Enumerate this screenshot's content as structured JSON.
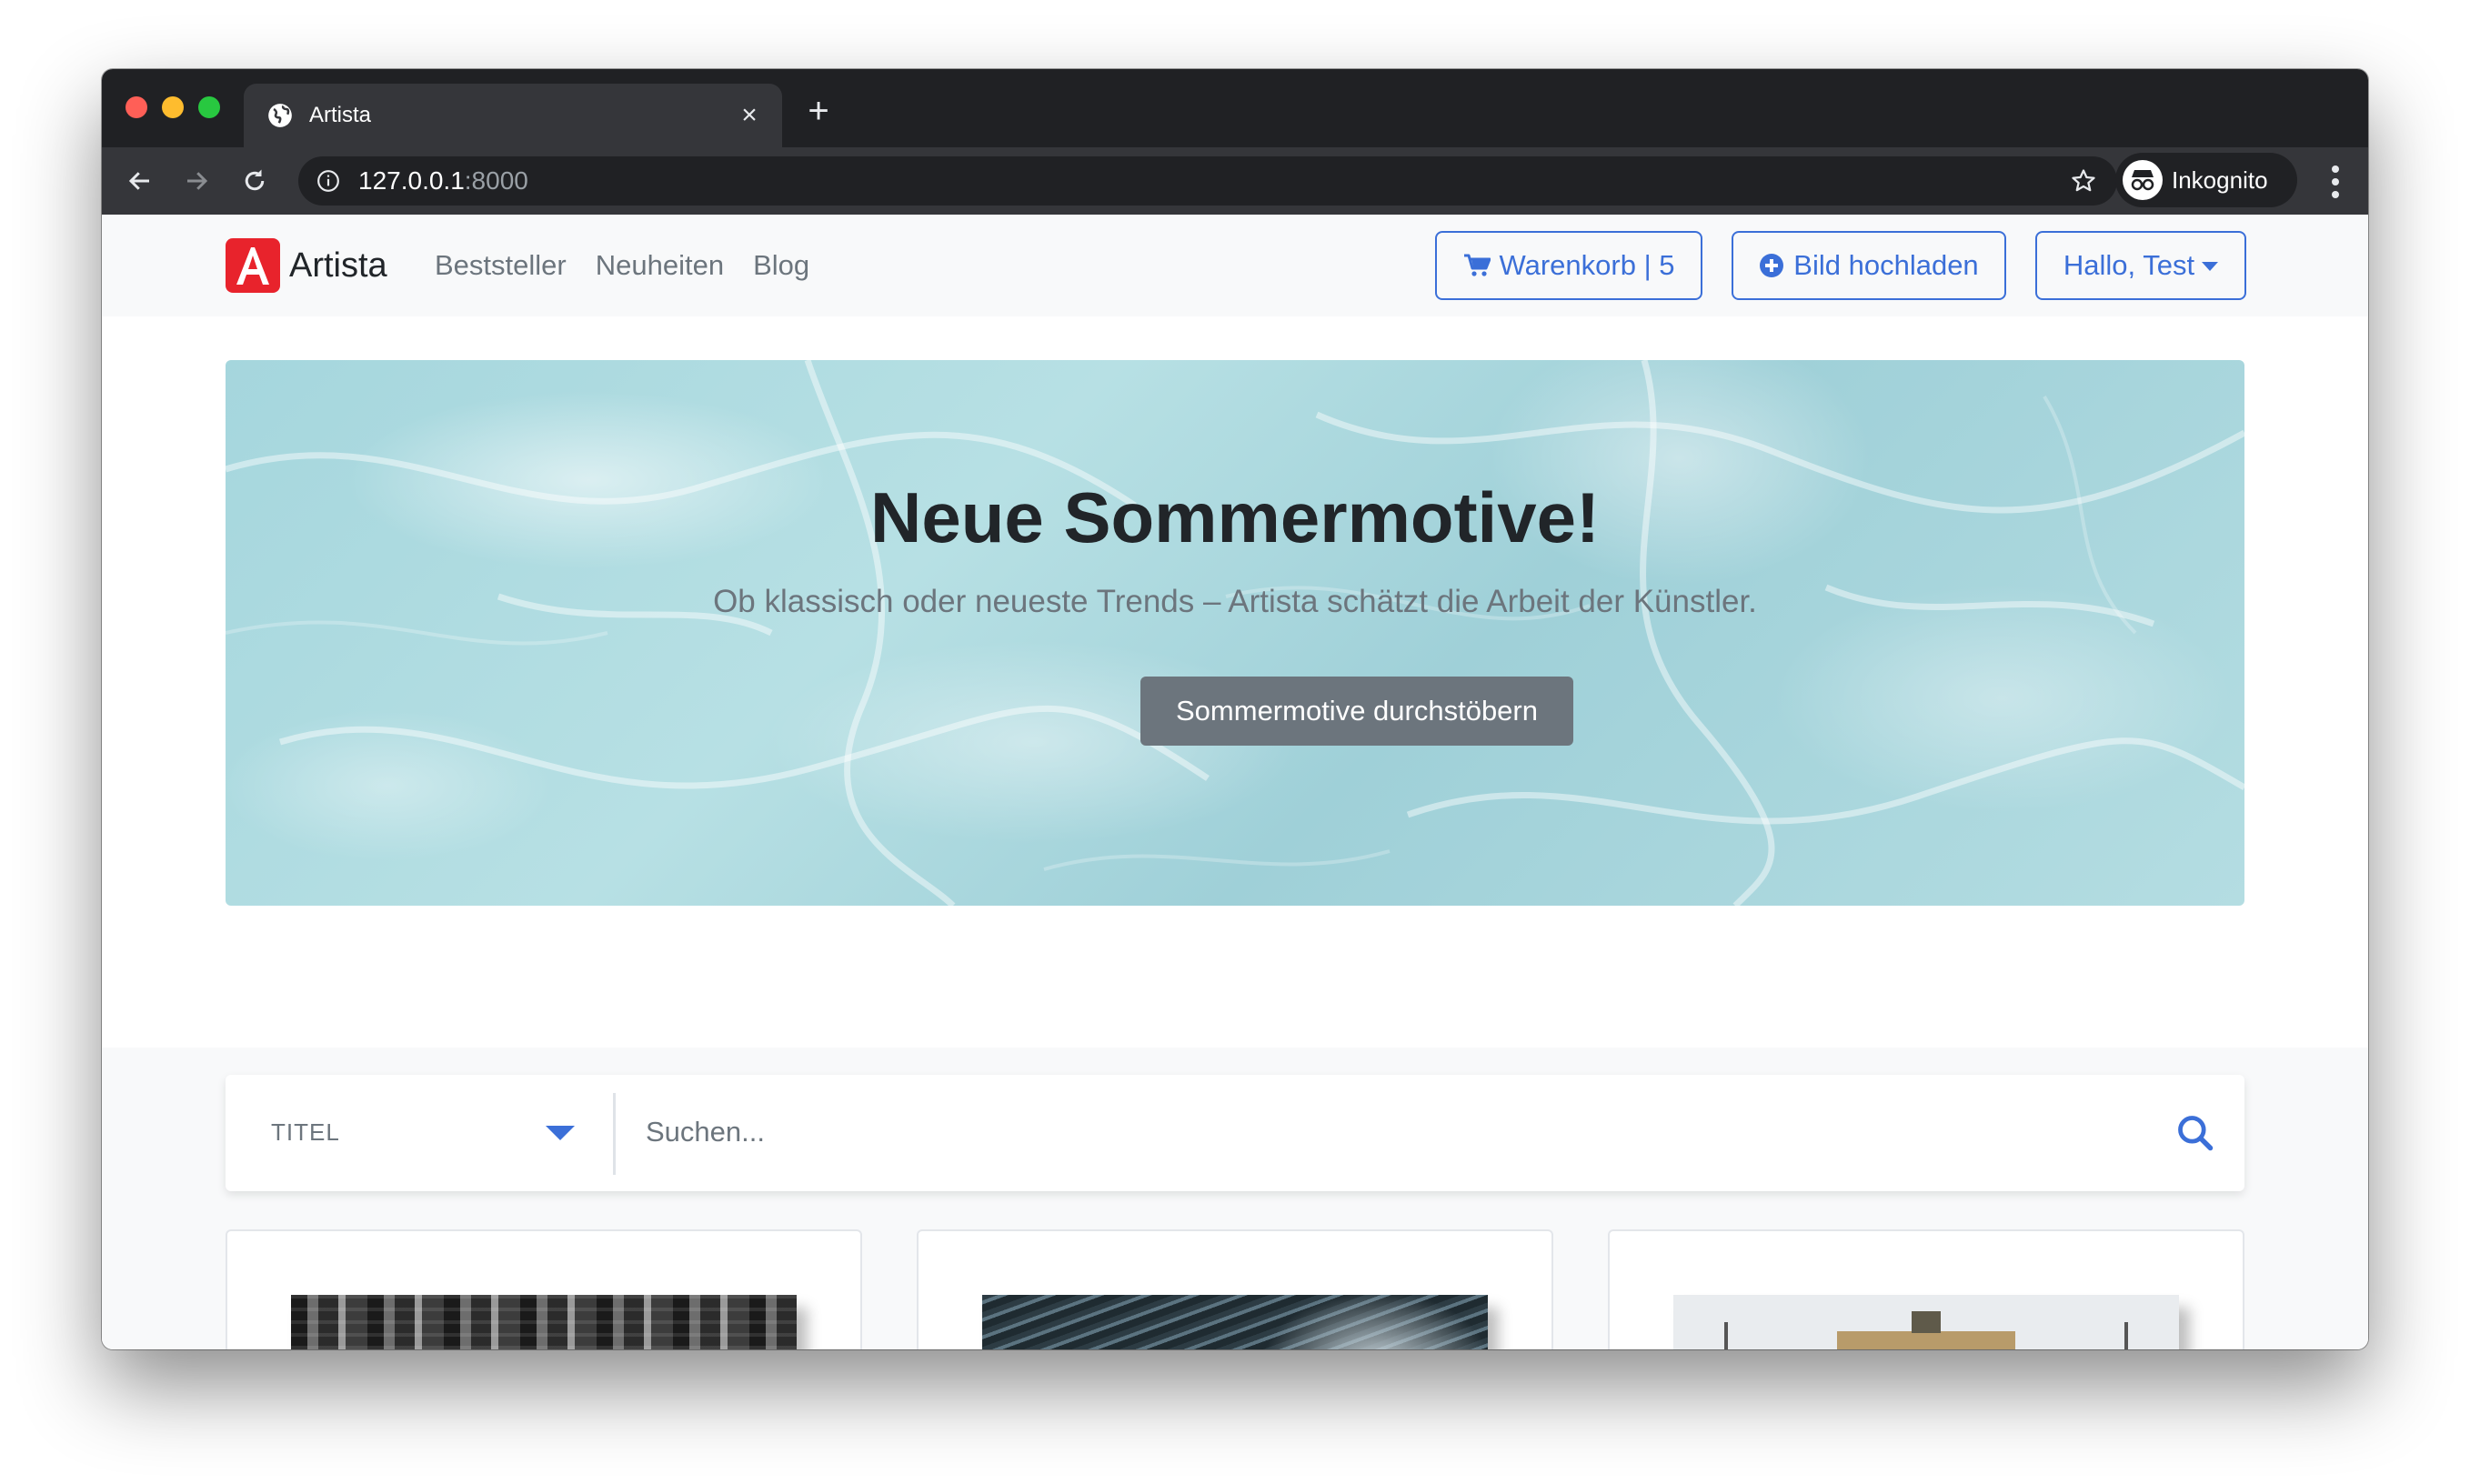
{
  "browser": {
    "tab_title": "Artista",
    "tab_close": "×",
    "new_tab": "+",
    "url_host": "127.0.0.1",
    "url_port": ":8000",
    "profile_label": "Inkognito"
  },
  "nav": {
    "brand": "Artista",
    "links": [
      "Beststeller",
      "Neuheiten",
      "Blog"
    ],
    "cart_label": "Warenkorb | 5",
    "upload_label": "Bild hochladen",
    "user_label": "Hallo, Test"
  },
  "hero": {
    "title": "Neue Sommermotive!",
    "subtitle": "Ob klassisch oder neueste Trends – Artista schätzt die Arbeit der Künstler.",
    "button": "Sommermotive durchstöbern"
  },
  "search": {
    "category": "TITEL",
    "placeholder": "Suchen..."
  },
  "cards": [
    {
      "image": "city-skyline"
    },
    {
      "image": "fish-swarm"
    },
    {
      "image": "brandenburg-gate"
    }
  ],
  "colors": {
    "accent": "#3b6fd8",
    "brand": "#e8232c",
    "hero_button": "#6c757d"
  }
}
